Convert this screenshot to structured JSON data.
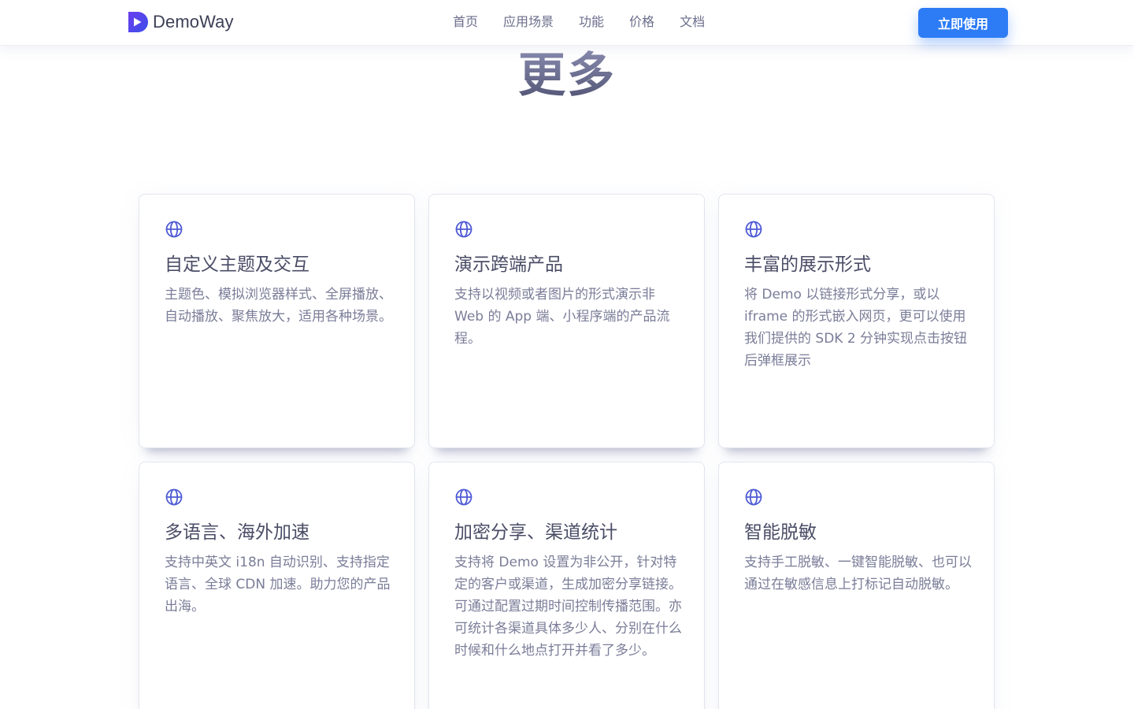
{
  "header": {
    "brand": "DemoWay",
    "nav": [
      "首页",
      "应用场景",
      "功能",
      "价格",
      "文档"
    ],
    "cta_label": "立即使用",
    "brand_color": "#5b3fe0",
    "cta_color": "#2d7cf6"
  },
  "section": {
    "title": "更多"
  },
  "cards": [
    {
      "icon": "globe-icon",
      "title": "自定义主题及交互",
      "desc": "主题色、模拟浏览器样式、全屏播放、自动播放、聚焦放大，适用各种场景。"
    },
    {
      "icon": "globe-icon",
      "title": "演示跨端产品",
      "desc": "支持以视频或者图片的形式演示非 Web 的 App 端、小程序端的产品流程。"
    },
    {
      "icon": "globe-icon",
      "title": "丰富的展示形式",
      "desc": "将 Demo 以链接形式分享，或以 iframe 的形式嵌入网页，更可以使用我们提供的 SDK 2 分钟实现点击按钮后弹框展示"
    },
    {
      "icon": "globe-icon",
      "title": "多语言、海外加速",
      "desc": "支持中英文 i18n 自动识别、支持指定语言、全球 CDN 加速。助力您的产品出海。"
    },
    {
      "icon": "globe-icon",
      "title": "加密分享、渠道统计",
      "desc": "支持将 Demo 设置为非公开，针对特定的客户或渠道，生成加密分享链接。可通过配置过期时间控制传播范围。亦可统计各渠道具体多少人、分别在什么时候和什么地点打开并看了多少。"
    },
    {
      "icon": "globe-icon",
      "title": "智能脱敏",
      "desc": "支持手工脱敏、一键智能脱敏、也可以通过在敏感信息上打标记自动脱敏。"
    }
  ]
}
